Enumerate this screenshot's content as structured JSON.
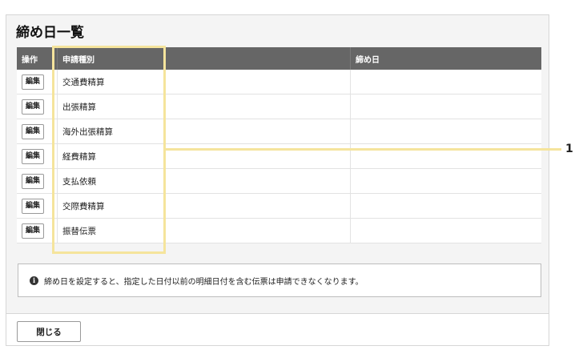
{
  "dialog": {
    "title": "締め日一覧",
    "columns": {
      "operation": "操作",
      "type": "申請種別",
      "closing_date": "締め日"
    },
    "rows": [
      {
        "edit": "編集",
        "type": "交通費精算",
        "closing_date": ""
      },
      {
        "edit": "編集",
        "type": "出張精算",
        "closing_date": ""
      },
      {
        "edit": "編集",
        "type": "海外出張精算",
        "closing_date": ""
      },
      {
        "edit": "編集",
        "type": "経費精算",
        "closing_date": ""
      },
      {
        "edit": "編集",
        "type": "支払依頼",
        "closing_date": ""
      },
      {
        "edit": "編集",
        "type": "交際費精算",
        "closing_date": ""
      },
      {
        "edit": "編集",
        "type": "振替伝票",
        "closing_date": ""
      }
    ],
    "notice": {
      "icon": "info-icon",
      "text": "締め日を設定すると、指定した日付以前の明細日付を含む伝票は申請できなくなります。"
    },
    "close_label": "閉じる"
  },
  "annotation": {
    "callout_number": "1",
    "color": "#f5e49c"
  }
}
